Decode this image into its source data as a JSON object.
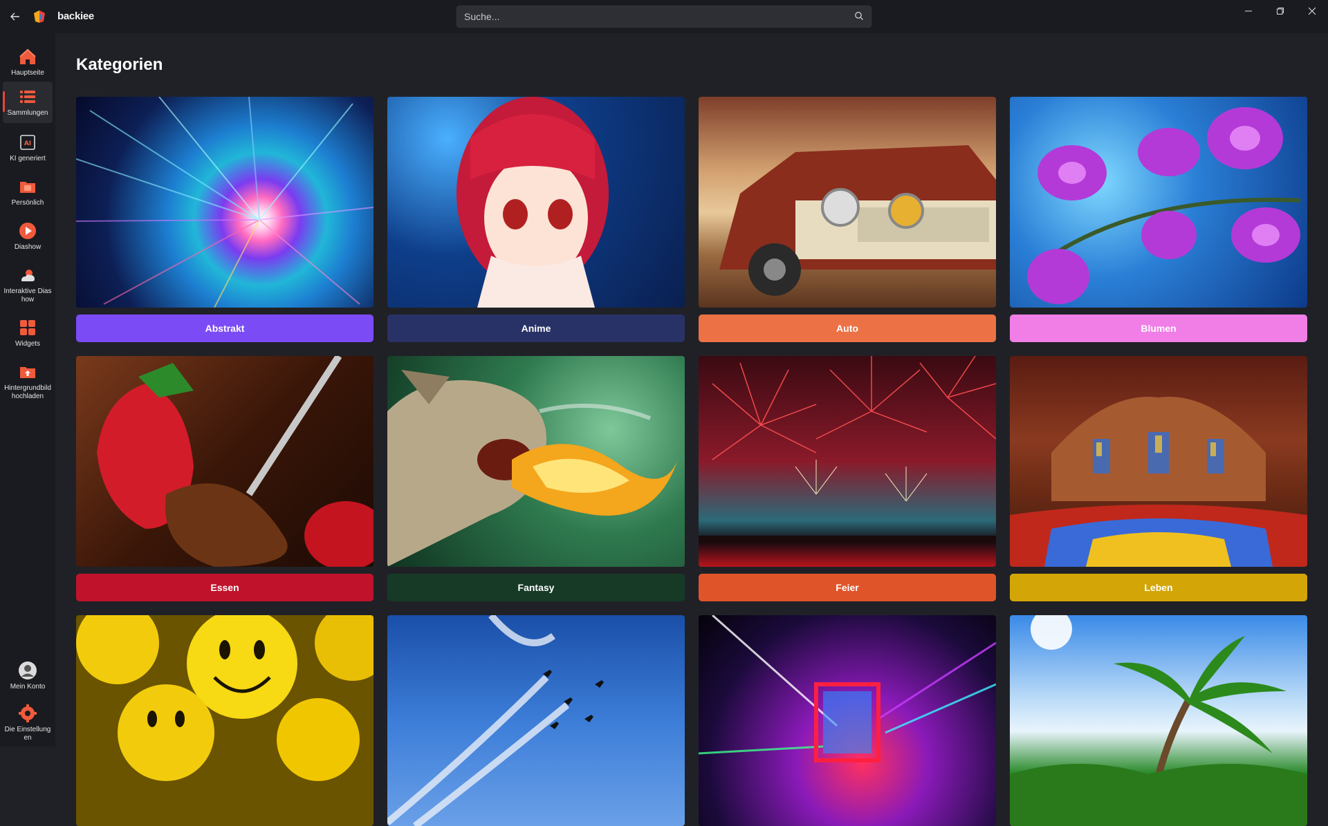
{
  "app": {
    "name": "backiee"
  },
  "search": {
    "placeholder": "Suche..."
  },
  "sidebar": {
    "items": [
      {
        "label": "Hauptseite",
        "icon": "home-icon"
      },
      {
        "label": "Sammlungen",
        "icon": "list-icon"
      },
      {
        "label": "KI generiert",
        "icon": "ai-image-icon"
      },
      {
        "label": "Persönlich",
        "icon": "folder-icon"
      },
      {
        "label": "Diashow",
        "icon": "play-icon"
      },
      {
        "label": "Interaktive Diashow",
        "icon": "weather-icon"
      },
      {
        "label": "Widgets",
        "icon": "widgets-icon"
      },
      {
        "label": "Hintergrundbild hochladen",
        "icon": "upload-icon"
      }
    ],
    "bottom": [
      {
        "label": "Mein Konto",
        "icon": "avatar-icon"
      },
      {
        "label": "Die Einstellungen",
        "icon": "gear-icon"
      }
    ]
  },
  "main": {
    "title": "Kategorien",
    "categories": [
      {
        "label": "Abstrakt",
        "color": "#7b4cf5",
        "image": "abstract-swirl"
      },
      {
        "label": "Anime",
        "color": "#283266",
        "image": "anime-girl"
      },
      {
        "label": "Auto",
        "color": "#ec7246",
        "image": "vintage-truck"
      },
      {
        "label": "Blumen",
        "color": "#f07ee6",
        "image": "orchids"
      },
      {
        "label": "Essen",
        "color": "#c0132b",
        "image": "chocolate-strawberry"
      },
      {
        "label": "Fantasy",
        "color": "#163a26",
        "image": "fire-cat"
      },
      {
        "label": "Feier",
        "color": "#e0542a",
        "image": "fireworks"
      },
      {
        "label": "Leben",
        "color": "#d3a507",
        "image": "mosque-interior"
      },
      {
        "label": "",
        "color": "#000000",
        "image": "smileys"
      },
      {
        "label": "",
        "color": "#000000",
        "image": "jets"
      },
      {
        "label": "",
        "color": "#000000",
        "image": "neon-lights"
      },
      {
        "label": "",
        "color": "#000000",
        "image": "palm-trees"
      }
    ]
  }
}
